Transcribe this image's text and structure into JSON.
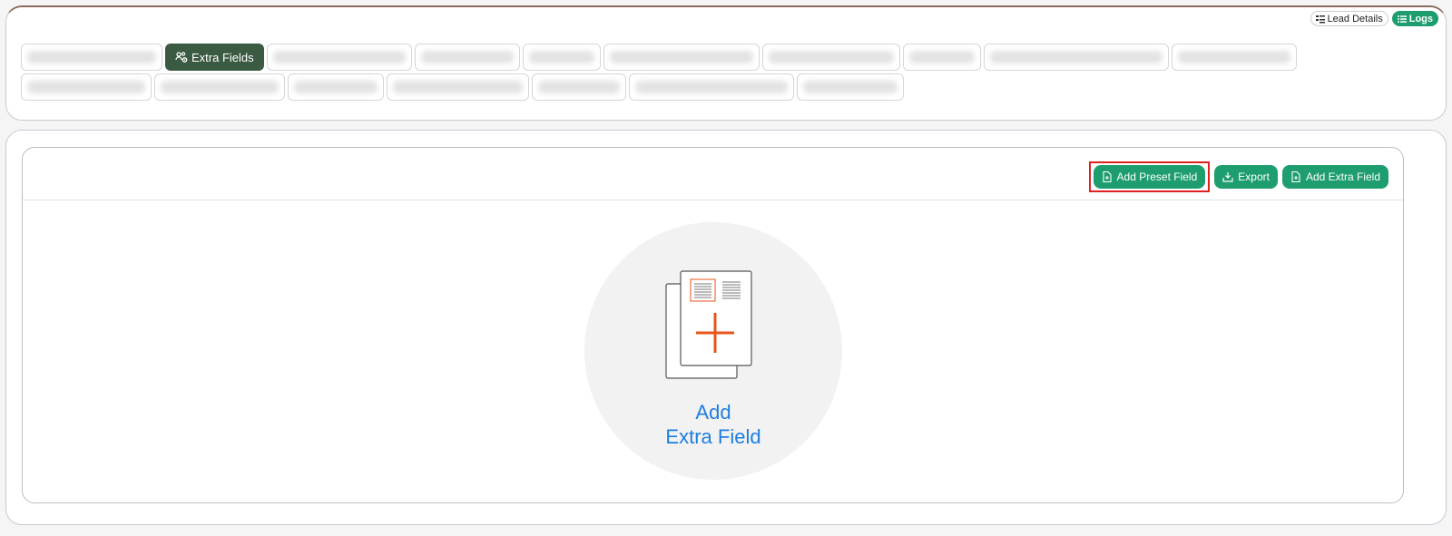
{
  "top_actions": {
    "lead_details_label": "Lead Details",
    "logs_label": "Logs"
  },
  "tabs": {
    "active_label": "Extra Fields"
  },
  "toolbar": {
    "add_preset_label": "Add Preset Field",
    "export_label": "Export",
    "add_extra_label": "Add Extra Field"
  },
  "empty_state": {
    "line1": "Add",
    "line2": "Extra Field"
  },
  "colors": {
    "accent_green": "#1e9e6e",
    "active_tab": "#3b5a42",
    "link_blue": "#1f7ee0",
    "plus_orange": "#e8541b",
    "highlight_red": "#e02020"
  }
}
